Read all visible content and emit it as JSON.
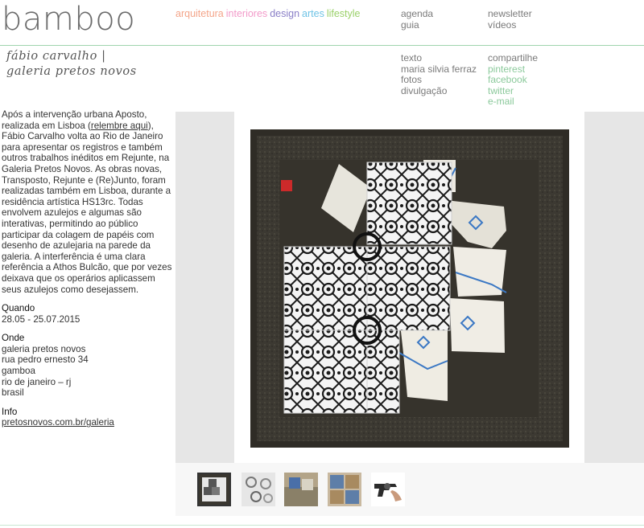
{
  "brand": {
    "logo": "bamboo"
  },
  "categories": [
    {
      "label": "arquitetura",
      "color": "#f4a58a"
    },
    {
      "label": "interiores",
      "color": "#f29ac9"
    },
    {
      "label": "design",
      "color": "#8a7fc7"
    },
    {
      "label": "artes",
      "color": "#6fc3e6"
    },
    {
      "label": "lifestyle",
      "color": "#9bd16a"
    }
  ],
  "nav": {
    "col1": [
      "agenda",
      "guia"
    ],
    "col2": [
      "newsletter",
      "vídeos"
    ]
  },
  "article": {
    "title_line1": "fábio carvalho |",
    "title_line2": "galeria pretos novos",
    "credits": [
      "texto",
      "maria silvia ferraz",
      "fotos",
      "divulgação"
    ],
    "share": {
      "label": "compartilhe",
      "links": [
        "pinterest",
        "facebook",
        "twitter",
        "e-mail"
      ]
    },
    "body_part1": "Após a intervenção urbana Aposto, realizada em Lisboa (",
    "body_link": "relembre aqui",
    "body_part2": "), Fábio Carvalho volta ao Rio de Janeiro para apresentar os registros e também outros trabalhos inéditos em Rejunte, na Galeria Pretos Novos. As obras novas, Transposto, Rejunte e (Re)Junto, foram realizadas também em Lisboa, durante a residência artística HS13rc. Todas envolvem azulejos e algumas são interativas, permitindo ao público participar da colagem de papéis com desenho de azulejaria na parede da galeria. A interferência é uma clara referência a Athos Bulcão, que por vezes deixava que os operários aplicassem seus azulejos como desejassem.",
    "when_label": "Quando",
    "when_value": "28.05 - 25.07.2015",
    "where_label": "Onde",
    "where_lines": [
      "galeria pretos novos",
      "rua pedro ernesto 34",
      "gamboa",
      "rio de janeiro – rj",
      "brasil"
    ],
    "info_label": "Info",
    "info_link": "pretosnovos.com.br/galeria"
  },
  "gallery": {
    "thumbnails": [
      "thumbnail-1",
      "thumbnail-2",
      "thumbnail-3",
      "thumbnail-4",
      "thumbnail-5"
    ],
    "selected_index": 0
  }
}
